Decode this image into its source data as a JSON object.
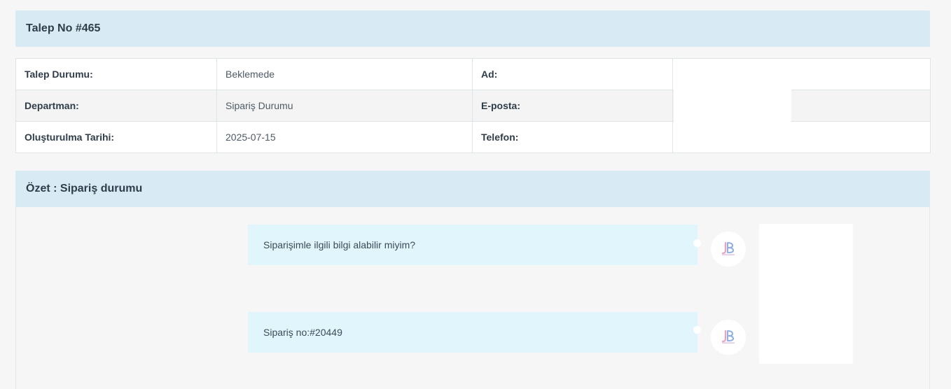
{
  "ticket": {
    "title": "Talep No #465"
  },
  "info": {
    "rows": [
      {
        "label_left": "Talep Durumu:",
        "value_left": "Beklemede",
        "label_right": "Ad:",
        "value_right": ""
      },
      {
        "label_left": "Departman:",
        "value_left": "Sipariş Durumu",
        "label_right": "E-posta:",
        "value_right": ""
      },
      {
        "label_left": "Oluşturulma Tarihi:",
        "value_left": "2025-07-15",
        "label_right": "Telefon:",
        "value_right": ""
      }
    ]
  },
  "summary": {
    "title": "Özet : Sipariş durumu"
  },
  "messages": [
    {
      "text": "Siparişimle ilgili bilgi alabilir miyim?",
      "avatar_icon": "jb-logo-icon"
    },
    {
      "text": "Sipariş no:#20449",
      "avatar_icon": "jb-logo-icon"
    }
  ],
  "colors": {
    "header_bg": "#d8ebf5",
    "bubble_bg": "#e1f6fc",
    "logo_pink": "#e9a3c2",
    "logo_blue": "#8fb0e0"
  }
}
